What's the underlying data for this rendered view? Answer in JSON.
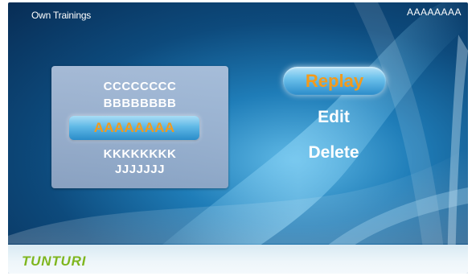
{
  "header": {
    "title": "Own Trainings",
    "user": "AAAAAAAA"
  },
  "training_list": {
    "items": [
      {
        "label": "CCCCCCCC",
        "selected": false
      },
      {
        "label": "BBBBBBBB",
        "selected": false
      },
      {
        "label": "AAAAAAAA",
        "selected": true
      },
      {
        "label": "KKKKKKKK",
        "selected": false
      },
      {
        "label": "JJJJJJJ",
        "selected": false
      }
    ]
  },
  "menu": {
    "items": [
      {
        "label": "Replay",
        "selected": true
      },
      {
        "label": "Edit",
        "selected": false
      },
      {
        "label": "Delete",
        "selected": false
      }
    ]
  },
  "footer": {
    "logo": "TUNTURI"
  },
  "colors": {
    "highlight_text": "#f39a1b",
    "logo": "#7fb61e"
  }
}
